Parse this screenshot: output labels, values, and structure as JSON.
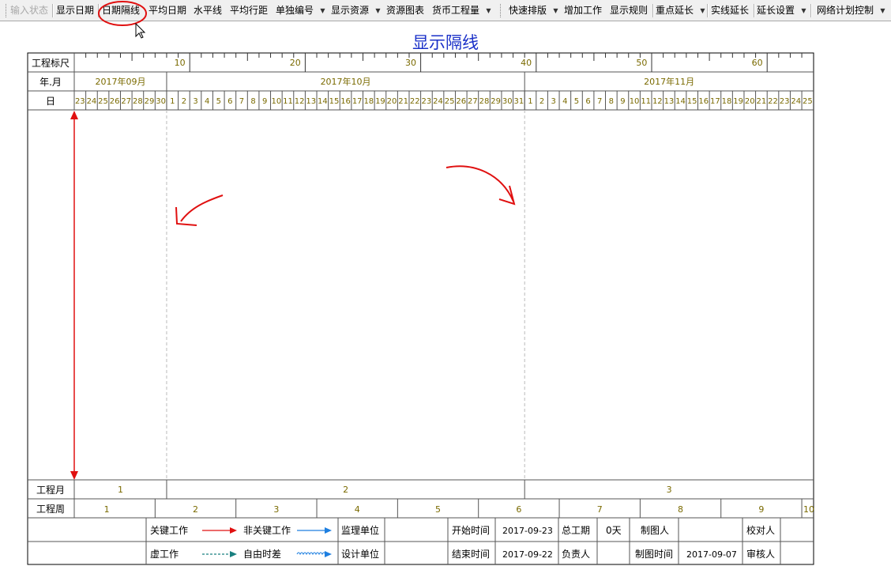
{
  "toolbar": {
    "items": [
      {
        "label": "输入状态",
        "disabled": true
      },
      {
        "label": "显示日期"
      },
      {
        "label": "日期隔线",
        "highlighted": true
      },
      {
        "label": "平均日期"
      },
      {
        "label": "水平线"
      },
      {
        "label": "平均行距"
      },
      {
        "label": "单独编号",
        "dropdown": true
      },
      {
        "label": "显示资源",
        "dropdown": true
      },
      {
        "label": "资源图表"
      },
      {
        "label": "货币工程量",
        "dropdown": true
      },
      {
        "label": "快速排版",
        "dropdown": true
      },
      {
        "label": "增加工作"
      },
      {
        "label": "显示规则"
      },
      {
        "label": "重点延长",
        "dropdown": true
      },
      {
        "label": "实线延长"
      },
      {
        "label": "延长设置",
        "dropdown": true
      },
      {
        "label": "网络计划控制",
        "dropdown": true
      }
    ]
  },
  "page": {
    "title": "显示隔线"
  },
  "gantt": {
    "row_labels": {
      "scale": "工程标尺",
      "month": "年.月",
      "day": "日",
      "proj_month": "工程月",
      "proj_week": "工程周"
    },
    "scale_ticks": [
      "10",
      "20",
      "30",
      "40",
      "50",
      "60"
    ],
    "months": [
      "2017年09月",
      "2017年10月",
      "2017年11月"
    ],
    "days": [
      "23",
      "24",
      "25",
      "26",
      "27",
      "28",
      "29",
      "30",
      "1",
      "2",
      "3",
      "4",
      "5",
      "6",
      "7",
      "8",
      "9",
      "10",
      "11",
      "12",
      "13",
      "14",
      "15",
      "16",
      "17",
      "18",
      "19",
      "20",
      "21",
      "22",
      "23",
      "24",
      "25",
      "26",
      "27",
      "28",
      "29",
      "30",
      "31",
      "1",
      "2",
      "3",
      "4",
      "5",
      "6",
      "7",
      "8",
      "9",
      "10",
      "11",
      "12",
      "13",
      "14",
      "15",
      "16",
      "17",
      "18",
      "19",
      "20",
      "21",
      "22",
      "23",
      "24",
      "25"
    ],
    "proj_months": [
      "1",
      "2",
      "3"
    ],
    "proj_weeks": [
      "1",
      "2",
      "3",
      "4",
      "5",
      "6",
      "7",
      "8",
      "9",
      "10"
    ]
  },
  "legend": {
    "critical": "关键工作",
    "noncritical": "非关键工作",
    "dummy": "虚工作",
    "free_float": "自由时差",
    "supervisor": "监理单位",
    "designer": "设计单位",
    "start_label": "开始时间",
    "start_value": "2017-09-23",
    "end_label": "结束时间",
    "end_value": "2017-09-22",
    "total_label": "总工期",
    "total_value": "0天",
    "owner_label": "负责人",
    "drafter_label": "制图人",
    "draw_time_label": "制图时间",
    "draw_time_value": "2017-09-07",
    "checker_label": "校对人",
    "reviewer_label": "审核人"
  },
  "colors": {
    "grid_text": "#7a6a00",
    "title": "#1a30c8",
    "critical_arrow": "#e01010",
    "noncritical_arrow": "#1e7fe0",
    "dummy_arrow": "#1a8080",
    "annotation": "#e01010"
  }
}
